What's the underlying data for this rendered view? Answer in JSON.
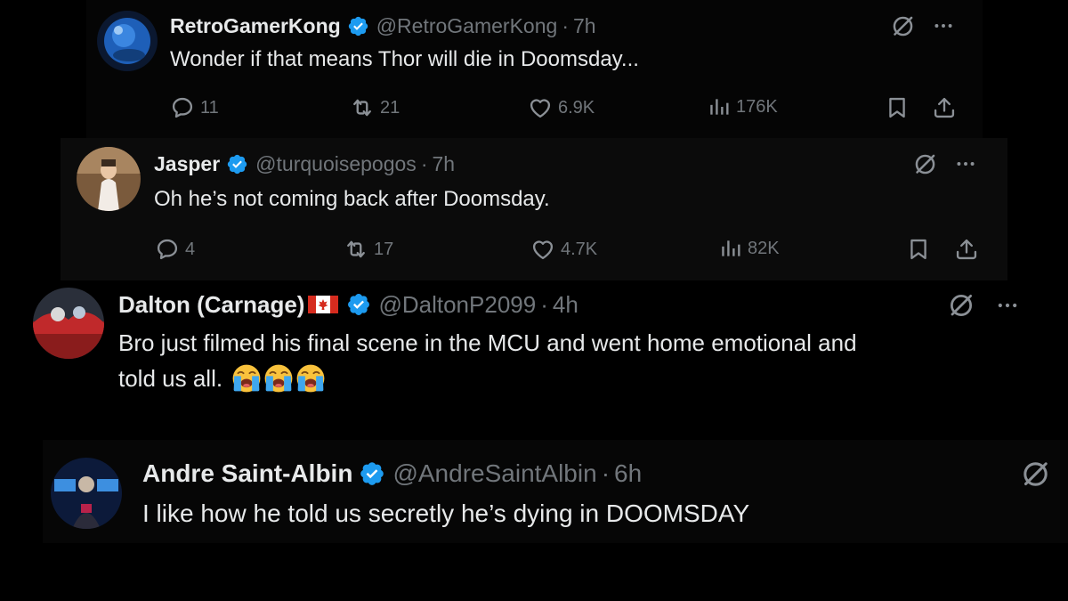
{
  "colors": {
    "background": "#000000",
    "text": "#e7e9ea",
    "secondary": "#71767b",
    "verified": "#1d9bf0"
  },
  "tweets": [
    {
      "name": "RetroGamerKong",
      "handle": "@RetroGamerKong",
      "separator": "·",
      "time": "7h",
      "text": "Wonder if that means Thor will die in Doomsday...",
      "actions": {
        "replies": "11",
        "reposts": "21",
        "likes": "6.9K",
        "views": "176K"
      }
    },
    {
      "name": "Jasper",
      "handle": "@turquoisepogos",
      "separator": "·",
      "time": "7h",
      "text": "Oh he’s not coming back after Doomsday.",
      "actions": {
        "replies": "4",
        "reposts": "17",
        "likes": "4.7K",
        "views": "82K"
      }
    },
    {
      "name": "Dalton (Carnage)",
      "flag_icon": "canada-flag-icon",
      "handle": "@DaltonP2099",
      "separator": "·",
      "time": "4h",
      "text_line1": "Bro just filmed his final scene in the MCU and went home emotional and",
      "text_line2": "told us all.",
      "emojis": [
        "loudly-crying-face-icon",
        "loudly-crying-face-icon",
        "loudly-crying-face-icon"
      ]
    },
    {
      "name": "Andre Saint-Albin",
      "handle": "@AndreSaintAlbin",
      "separator": "·",
      "time": "6h",
      "text": "I like how he told us secretly he’s dying in DOOMSDAY"
    }
  ]
}
